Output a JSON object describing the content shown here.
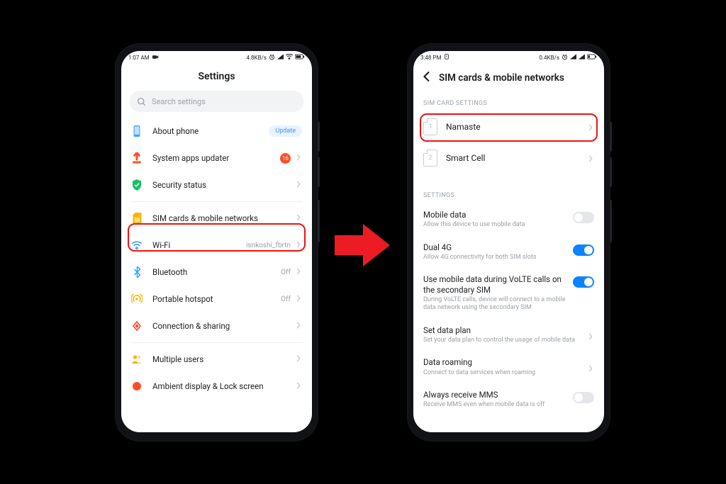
{
  "phone1": {
    "status": {
      "time": "1:07 AM",
      "speed": "4.8KB/s"
    },
    "header": "Settings",
    "search_placeholder": "Search settings",
    "items": {
      "about": {
        "label": "About phone",
        "badge": "Update"
      },
      "updater": {
        "label": "System apps updater",
        "count": "16"
      },
      "security": {
        "label": "Security status"
      },
      "sim": {
        "label": "SIM cards & mobile networks"
      },
      "wifi": {
        "label": "Wi-Fi",
        "value": "isnkoshi_fbrtn"
      },
      "bluetooth": {
        "label": "Bluetooth",
        "value": "Off"
      },
      "hotspot": {
        "label": "Portable hotspot",
        "value": "Off"
      },
      "connection": {
        "label": "Connection & sharing"
      },
      "multiuser": {
        "label": "Multiple users"
      },
      "ambient": {
        "label": "Ambient display & Lock screen"
      }
    }
  },
  "phone2": {
    "status": {
      "time": "3:48 PM",
      "speed": "0.4KB/s"
    },
    "header": "SIM cards & mobile networks",
    "section_sim": "SIM CARD SETTINGS",
    "sim1": {
      "num": "1",
      "label": "Namaste"
    },
    "sim2": {
      "num": "2",
      "label": "Smart Cell"
    },
    "section_settings": "SETTINGS",
    "settings": {
      "mobiledata": {
        "title": "Mobile data",
        "sub": "Allow this device to use mobile data"
      },
      "dual4g": {
        "title": "Dual 4G",
        "sub": "Allow 4G connectivity for both SIM slots"
      },
      "volte": {
        "title": "Use mobile data during VoLTE calls on the secondary SIM",
        "sub": "During VoLTE calls, device will connect to a mobile data network using the secondary SIM"
      },
      "dataplan": {
        "title": "Set data plan",
        "sub": "Set your data plan to control the usage of mobile data"
      },
      "roaming": {
        "title": "Data roaming",
        "sub": "Connect to data services when roaming"
      },
      "mms": {
        "title": "Always receive MMS",
        "sub": "Receive MMS even when mobile data is off"
      }
    }
  }
}
